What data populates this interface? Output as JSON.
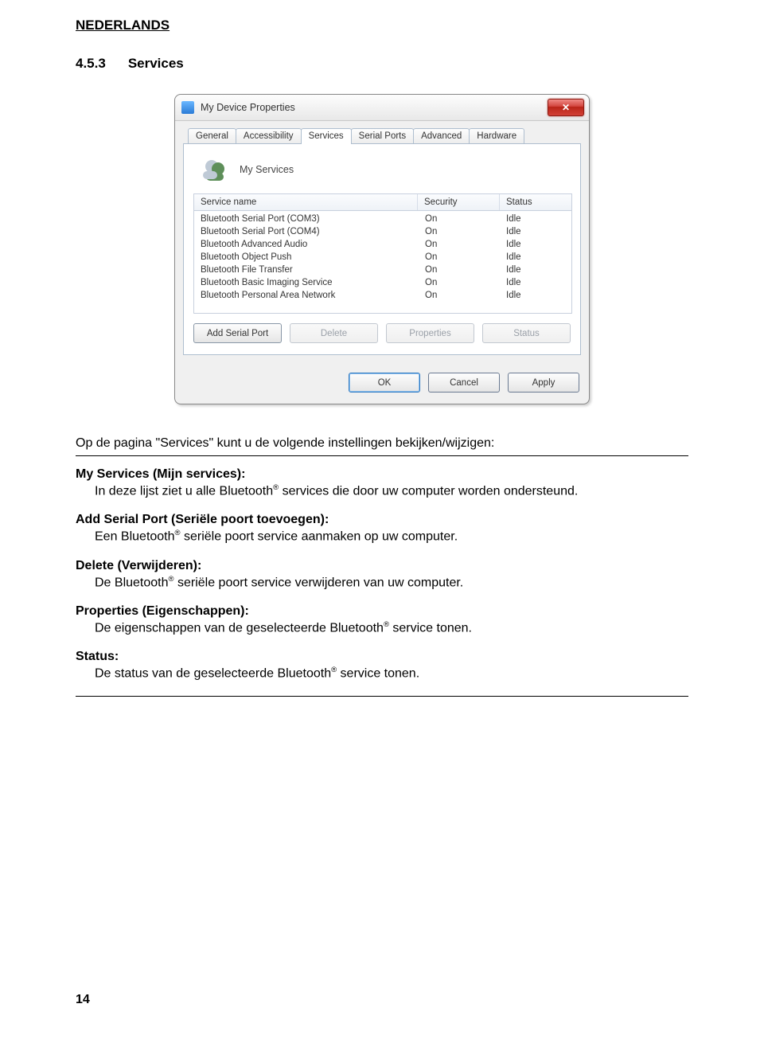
{
  "lang_title": "NEDERLANDS",
  "section": {
    "number": "4.5.3",
    "title": "Services"
  },
  "dialog": {
    "title": "My Device Properties",
    "tabs": [
      "General",
      "Accessibility",
      "Services",
      "Serial Ports",
      "Advanced",
      "Hardware"
    ],
    "active_tab_index": 2,
    "services_heading": "My Services",
    "columns": {
      "name": "Service name",
      "security": "Security",
      "status": "Status"
    },
    "rows": [
      {
        "name": "Bluetooth Serial Port (COM3)",
        "security": "On",
        "status": "Idle"
      },
      {
        "name": "Bluetooth Serial Port (COM4)",
        "security": "On",
        "status": "Idle"
      },
      {
        "name": "Bluetooth Advanced Audio",
        "security": "On",
        "status": "Idle"
      },
      {
        "name": "Bluetooth Object Push",
        "security": "On",
        "status": "Idle"
      },
      {
        "name": "Bluetooth File Transfer",
        "security": "On",
        "status": "Idle"
      },
      {
        "name": "Bluetooth Basic Imaging Service",
        "security": "On",
        "status": "Idle"
      },
      {
        "name": "Bluetooth Personal Area Network",
        "security": "On",
        "status": "Idle"
      }
    ],
    "panel_buttons": {
      "add": "Add Serial Port",
      "delete": "Delete",
      "properties": "Properties",
      "status": "Status"
    },
    "footer_buttons": {
      "ok": "OK",
      "cancel": "Cancel",
      "apply": "Apply"
    }
  },
  "intro": "Op de pagina \"Services\" kunt u de volgende instellingen bekijken/wijzigen:",
  "terms": [
    {
      "title": "My Services (Mijn services):",
      "desc_pre": "In deze lijst ziet u alle Bluetooth",
      "desc_post": " services die door uw computer worden ondersteund."
    },
    {
      "title": "Add Serial Port (Seriële poort toevoegen):",
      "desc_pre": "Een Bluetooth",
      "desc_post": " seriële poort service aanmaken op uw computer."
    },
    {
      "title": "Delete (Verwijderen):",
      "desc_pre": "De Bluetooth",
      "desc_post": " seriële poort service verwijderen van uw computer."
    },
    {
      "title": "Properties (Eigenschappen):",
      "desc_pre": "De eigenschappen van de geselecteerde Bluetooth",
      "desc_post": " service tonen."
    },
    {
      "title": "Status:",
      "desc_pre": "De status van de geselecteerde Bluetooth",
      "desc_post": " service tonen."
    }
  ],
  "reg_mark": "®",
  "page_number": "14"
}
